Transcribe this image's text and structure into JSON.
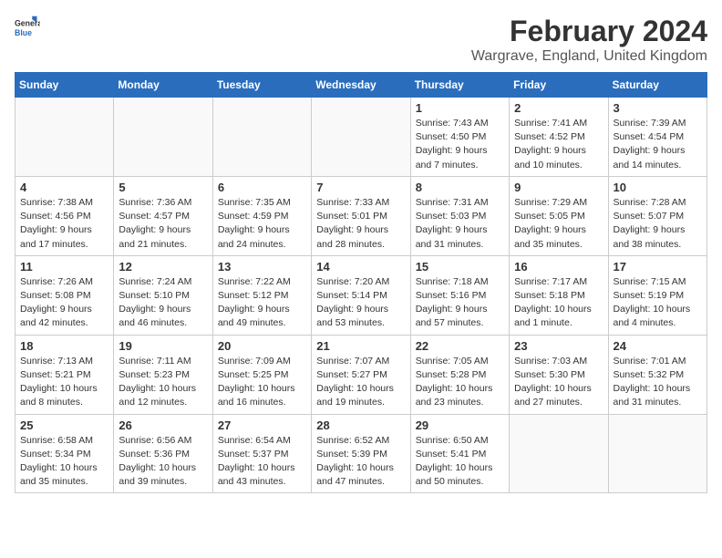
{
  "header": {
    "logo_general": "General",
    "logo_blue": "Blue",
    "month_title": "February 2024",
    "location": "Wargrave, England, United Kingdom"
  },
  "days_of_week": [
    "Sunday",
    "Monday",
    "Tuesday",
    "Wednesday",
    "Thursday",
    "Friday",
    "Saturday"
  ],
  "weeks": [
    [
      {
        "day": "",
        "info": ""
      },
      {
        "day": "",
        "info": ""
      },
      {
        "day": "",
        "info": ""
      },
      {
        "day": "",
        "info": ""
      },
      {
        "day": "1",
        "info": "Sunrise: 7:43 AM\nSunset: 4:50 PM\nDaylight: 9 hours\nand 7 minutes."
      },
      {
        "day": "2",
        "info": "Sunrise: 7:41 AM\nSunset: 4:52 PM\nDaylight: 9 hours\nand 10 minutes."
      },
      {
        "day": "3",
        "info": "Sunrise: 7:39 AM\nSunset: 4:54 PM\nDaylight: 9 hours\nand 14 minutes."
      }
    ],
    [
      {
        "day": "4",
        "info": "Sunrise: 7:38 AM\nSunset: 4:56 PM\nDaylight: 9 hours\nand 17 minutes."
      },
      {
        "day": "5",
        "info": "Sunrise: 7:36 AM\nSunset: 4:57 PM\nDaylight: 9 hours\nand 21 minutes."
      },
      {
        "day": "6",
        "info": "Sunrise: 7:35 AM\nSunset: 4:59 PM\nDaylight: 9 hours\nand 24 minutes."
      },
      {
        "day": "7",
        "info": "Sunrise: 7:33 AM\nSunset: 5:01 PM\nDaylight: 9 hours\nand 28 minutes."
      },
      {
        "day": "8",
        "info": "Sunrise: 7:31 AM\nSunset: 5:03 PM\nDaylight: 9 hours\nand 31 minutes."
      },
      {
        "day": "9",
        "info": "Sunrise: 7:29 AM\nSunset: 5:05 PM\nDaylight: 9 hours\nand 35 minutes."
      },
      {
        "day": "10",
        "info": "Sunrise: 7:28 AM\nSunset: 5:07 PM\nDaylight: 9 hours\nand 38 minutes."
      }
    ],
    [
      {
        "day": "11",
        "info": "Sunrise: 7:26 AM\nSunset: 5:08 PM\nDaylight: 9 hours\nand 42 minutes."
      },
      {
        "day": "12",
        "info": "Sunrise: 7:24 AM\nSunset: 5:10 PM\nDaylight: 9 hours\nand 46 minutes."
      },
      {
        "day": "13",
        "info": "Sunrise: 7:22 AM\nSunset: 5:12 PM\nDaylight: 9 hours\nand 49 minutes."
      },
      {
        "day": "14",
        "info": "Sunrise: 7:20 AM\nSunset: 5:14 PM\nDaylight: 9 hours\nand 53 minutes."
      },
      {
        "day": "15",
        "info": "Sunrise: 7:18 AM\nSunset: 5:16 PM\nDaylight: 9 hours\nand 57 minutes."
      },
      {
        "day": "16",
        "info": "Sunrise: 7:17 AM\nSunset: 5:18 PM\nDaylight: 10 hours\nand 1 minute."
      },
      {
        "day": "17",
        "info": "Sunrise: 7:15 AM\nSunset: 5:19 PM\nDaylight: 10 hours\nand 4 minutes."
      }
    ],
    [
      {
        "day": "18",
        "info": "Sunrise: 7:13 AM\nSunset: 5:21 PM\nDaylight: 10 hours\nand 8 minutes."
      },
      {
        "day": "19",
        "info": "Sunrise: 7:11 AM\nSunset: 5:23 PM\nDaylight: 10 hours\nand 12 minutes."
      },
      {
        "day": "20",
        "info": "Sunrise: 7:09 AM\nSunset: 5:25 PM\nDaylight: 10 hours\nand 16 minutes."
      },
      {
        "day": "21",
        "info": "Sunrise: 7:07 AM\nSunset: 5:27 PM\nDaylight: 10 hours\nand 19 minutes."
      },
      {
        "day": "22",
        "info": "Sunrise: 7:05 AM\nSunset: 5:28 PM\nDaylight: 10 hours\nand 23 minutes."
      },
      {
        "day": "23",
        "info": "Sunrise: 7:03 AM\nSunset: 5:30 PM\nDaylight: 10 hours\nand 27 minutes."
      },
      {
        "day": "24",
        "info": "Sunrise: 7:01 AM\nSunset: 5:32 PM\nDaylight: 10 hours\nand 31 minutes."
      }
    ],
    [
      {
        "day": "25",
        "info": "Sunrise: 6:58 AM\nSunset: 5:34 PM\nDaylight: 10 hours\nand 35 minutes."
      },
      {
        "day": "26",
        "info": "Sunrise: 6:56 AM\nSunset: 5:36 PM\nDaylight: 10 hours\nand 39 minutes."
      },
      {
        "day": "27",
        "info": "Sunrise: 6:54 AM\nSunset: 5:37 PM\nDaylight: 10 hours\nand 43 minutes."
      },
      {
        "day": "28",
        "info": "Sunrise: 6:52 AM\nSunset: 5:39 PM\nDaylight: 10 hours\nand 47 minutes."
      },
      {
        "day": "29",
        "info": "Sunrise: 6:50 AM\nSunset: 5:41 PM\nDaylight: 10 hours\nand 50 minutes."
      },
      {
        "day": "",
        "info": ""
      },
      {
        "day": "",
        "info": ""
      }
    ]
  ]
}
